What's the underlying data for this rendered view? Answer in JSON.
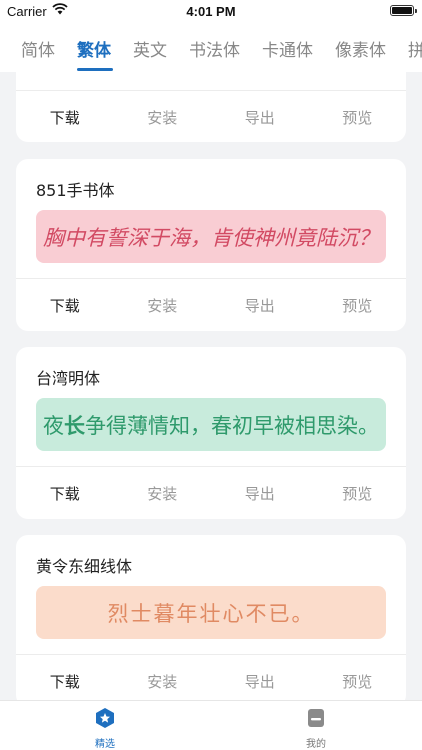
{
  "status_bar": {
    "carrier": "Carrier",
    "time": "4:01 PM"
  },
  "category_tabs": [
    {
      "label": "简体",
      "active": false
    },
    {
      "label": "繁体",
      "active": true
    },
    {
      "label": "英文",
      "active": false
    },
    {
      "label": "书法体",
      "active": false
    },
    {
      "label": "卡通体",
      "active": false
    },
    {
      "label": "像素体",
      "active": false
    },
    {
      "label": "拼",
      "active": false
    }
  ],
  "actions": {
    "download": "下载",
    "install": "安装",
    "export": "导出",
    "preview": "预览"
  },
  "fonts": [
    {
      "name": "851手书体",
      "sample": "胸中有誓深于海，肯使神州竟陆沉？",
      "preview_bg": "#f9cdd3",
      "preview_color": "#d24a63"
    },
    {
      "name": "台湾明体",
      "sample_prefix": "夜",
      "sample_bold": "长",
      "sample_suffix": "争得薄情知，春初早被相思染。",
      "preview_bg": "#c8ebdc",
      "preview_color": "#2f9a6c"
    },
    {
      "name": "黄令东细线体",
      "sample": "烈士暮年壮心不已。",
      "preview_bg": "#fbdccb",
      "preview_color": "#e08a63"
    }
  ],
  "bottom_tabs": [
    {
      "label": "精选",
      "active": true
    },
    {
      "label": "我的",
      "active": false
    }
  ],
  "colors": {
    "accent": "#1e6fbf",
    "inactive": "#888888",
    "background": "#f2f3f5"
  }
}
